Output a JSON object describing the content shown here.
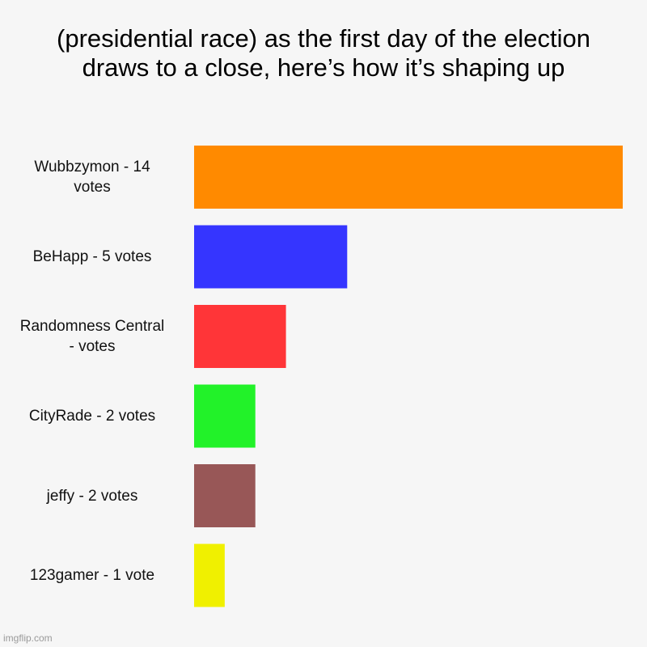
{
  "chart_data": {
    "type": "bar",
    "orientation": "horizontal",
    "title": "(presidential race) as the first day of the election draws to a close, here’s how it’s shaping up",
    "xlabel": "",
    "ylabel": "",
    "grid": false,
    "legend": "none",
    "categories": [
      "Wubbzymon - 14 votes",
      "BeHapp - 5 votes",
      "Randomness Central - votes",
      "CityRade - 2 votes",
      "jeffy - 2 votes",
      "123gamer - 1 vote"
    ],
    "values": [
      14,
      5,
      3,
      2,
      2,
      1
    ],
    "colors": [
      "#ff8a00",
      "#3535ff",
      "#ff3538",
      "#22f229",
      "#985757",
      "#f0f000"
    ],
    "xlim": [
      0,
      14
    ]
  },
  "watermark": "imgflip.com"
}
